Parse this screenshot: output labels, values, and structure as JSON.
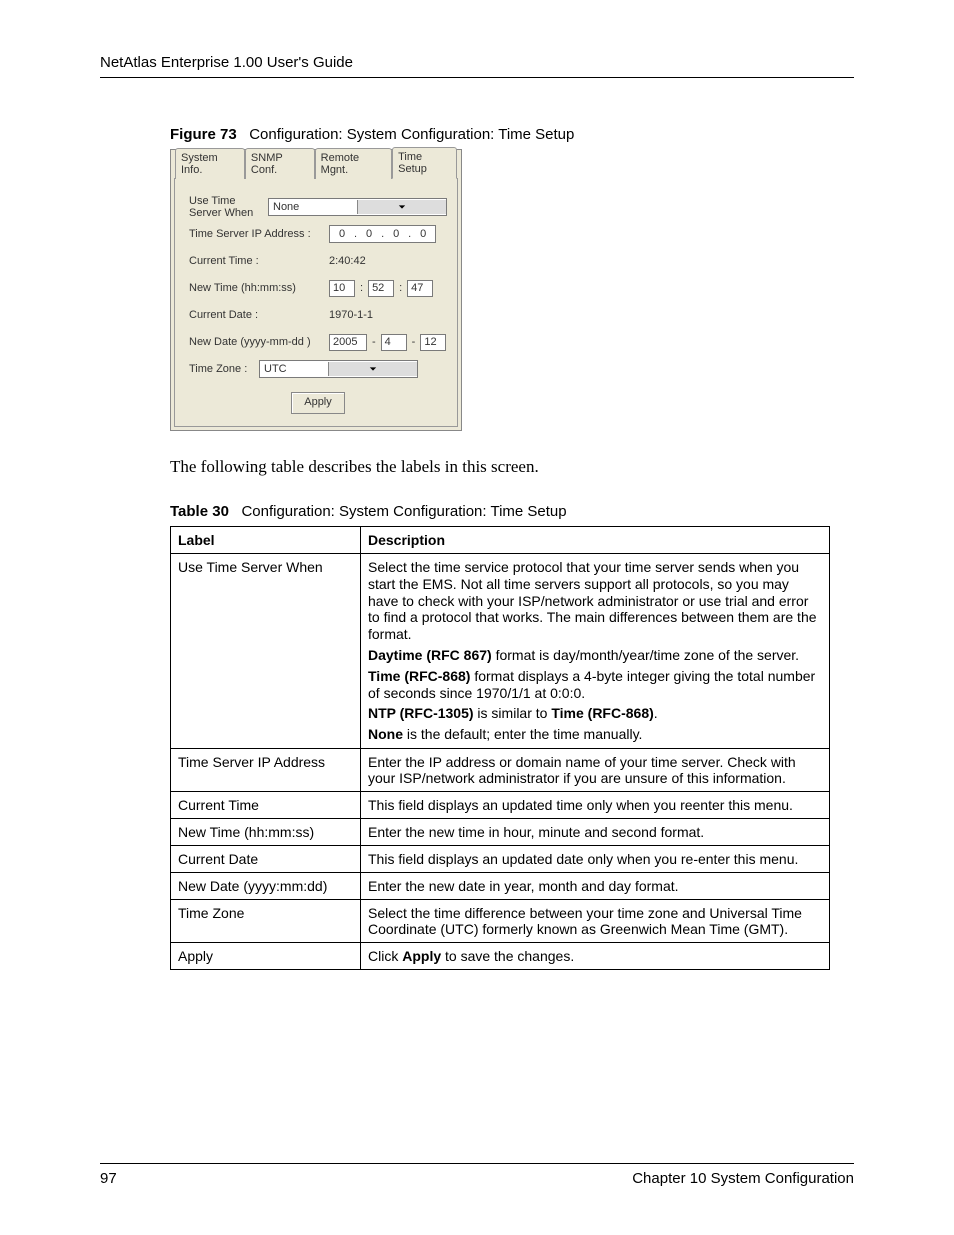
{
  "header": {
    "title": "NetAtlas Enterprise 1.00 User's Guide"
  },
  "figure": {
    "label": "Figure 73",
    "caption": "Configuration: System Configuration: Time Setup"
  },
  "screenshot": {
    "tabs": [
      "System Info.",
      "SNMP Conf.",
      "Remote Mgnt.",
      "Time Setup"
    ],
    "active_tab": 3,
    "fields": {
      "use_time_server_label": "Use Time Server When",
      "use_time_server_value": "None",
      "ip_label": "Time Server IP Address :",
      "ip": [
        "0",
        "0",
        "0",
        "0"
      ],
      "current_time_label": "Current Time :",
      "current_time_value": "2:40:42",
      "new_time_label": "New Time (hh:mm:ss)",
      "new_time": [
        "10",
        "52",
        "47"
      ],
      "current_date_label": "Current Date :",
      "current_date_value": "1970-1-1",
      "new_date_label": "New Date (yyyy-mm-dd )",
      "new_date": [
        "2005",
        "4",
        "12"
      ],
      "timezone_label": "Time Zone :",
      "timezone_value": "UTC",
      "apply": "Apply"
    }
  },
  "intro": "The following table describes the labels in this screen.",
  "table": {
    "label": "Table 30",
    "caption": "Configuration: System Configuration: Time Setup",
    "head": {
      "c1": "Label",
      "c2": "Description"
    },
    "rows": {
      "r0": {
        "label": "Use Time Server When",
        "p1": "Select the time service protocol that your time server sends when you start the EMS. Not all time servers support all protocols, so you may have to check with your ISP/network administrator or use trial and error to find a protocol that works. The main differences between them are the format.",
        "p2a": "Daytime (RFC 867)",
        "p2b": " format is day/month/year/time zone of the server.",
        "p3a": "Time (RFC-868)",
        "p3b": " format displays a 4-byte integer giving the total number of seconds since 1970/1/1 at 0:0:0.",
        "p4a": "NTP (RFC-1305)",
        "p4b": " is similar to ",
        "p4c": "Time (RFC-868)",
        "p4d": ".",
        "p5a": "None",
        "p5b": " is the default; enter the time manually."
      },
      "r1": {
        "label": "Time Server IP Address",
        "desc": "Enter the IP address or domain name of your time server. Check with your ISP/network administrator if you are unsure of this information."
      },
      "r2": {
        "label": "Current Time",
        "desc": "This field displays an updated time only when you reenter this menu."
      },
      "r3": {
        "label": "New Time (hh:mm:ss)",
        "desc": "Enter the new time in hour, minute and second format."
      },
      "r4": {
        "label": "Current Date",
        "desc": "This field displays an updated date only when you re-enter this menu."
      },
      "r5": {
        "label": "New Date (yyyy:mm:dd)",
        "desc": "Enter the new date in year, month and day format."
      },
      "r6": {
        "label": "Time Zone",
        "desc": "Select the time difference between your time zone and Universal Time Coordinate (UTC) formerly known as Greenwich Mean Time (GMT)."
      },
      "r7": {
        "label": "Apply",
        "d_a": "Click ",
        "d_b": "Apply",
        "d_c": " to save the changes."
      }
    }
  },
  "footer": {
    "page": "97",
    "chapter": "Chapter 10 System Configuration"
  }
}
